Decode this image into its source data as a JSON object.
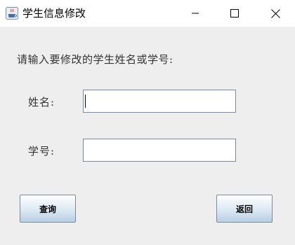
{
  "window": {
    "title": "学生信息修改",
    "icon": "java-coffee-cup-icon",
    "controls": [
      "minimize-icon",
      "maximize-icon",
      "close-icon"
    ]
  },
  "form": {
    "prompt": "请输入要修改的学生姓名或学号:",
    "name_label": "姓名:",
    "name_value": "",
    "id_label": "学号:",
    "id_value": ""
  },
  "buttons": {
    "query_label": "查询",
    "back_label": "返回"
  },
  "colors": {
    "content_bg": "#eeeeee",
    "titlebar_bg": "#ffffff",
    "field_border": "#7a8a99",
    "button_gradient_bottom": "#b8cfe5"
  }
}
